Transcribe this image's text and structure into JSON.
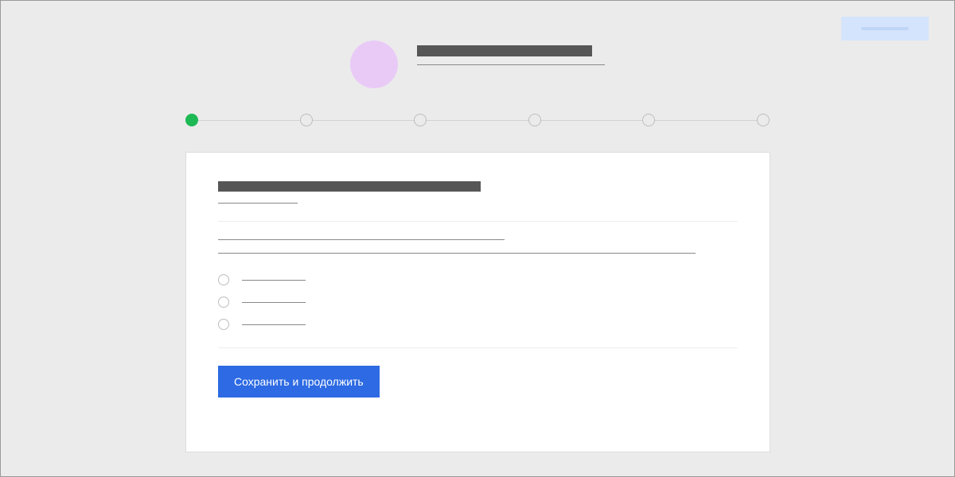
{
  "header": {
    "title": "",
    "subtitle": ""
  },
  "top_action": {
    "label": ""
  },
  "stepper": {
    "steps": [
      {
        "active": true
      },
      {
        "active": false
      },
      {
        "active": false
      },
      {
        "active": false
      },
      {
        "active": false
      },
      {
        "active": false
      }
    ]
  },
  "form": {
    "heading": "",
    "subheading": "",
    "question_line_1": "",
    "question_line_2": "",
    "options": [
      {
        "label": ""
      },
      {
        "label": ""
      },
      {
        "label": ""
      }
    ],
    "submit_label": "Сохранить и продолжить"
  }
}
